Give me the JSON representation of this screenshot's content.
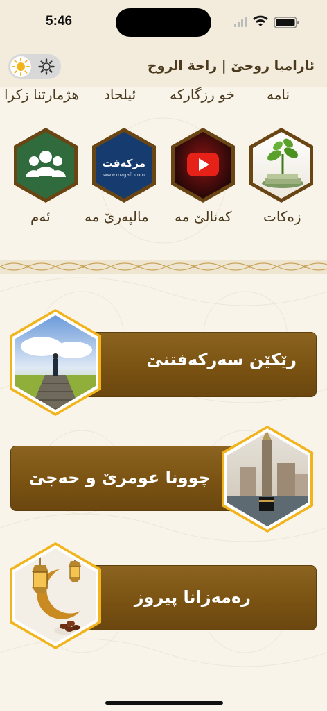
{
  "status_bar": {
    "time": "5:46"
  },
  "header": {
    "title": "ئاراميا روحێ | راحة الروح",
    "theme_toggle": {
      "light_icon": "sun-icon",
      "dark_icon": "gear-icon"
    }
  },
  "top_labels": [
    "نامە",
    "خو رزگاركە",
    "ئيلحاد",
    "هژمارتنا زكرا"
  ],
  "tiles": [
    {
      "label": "زەکات",
      "icon": "money-plant-icon"
    },
    {
      "label": "كەنالێ مە",
      "icon": "youtube-icon"
    },
    {
      "label": "مالپەرێ مە",
      "icon": "mzgaft-logo",
      "logo_text": "مزكەفت",
      "logo_sub": "www.mzgaft.com"
    },
    {
      "label": "ئەم",
      "icon": "users-icon"
    }
  ],
  "cards": [
    {
      "label": "رێكێن سەركەفتنێ",
      "image": "stairs-path-image"
    },
    {
      "label": "چوونا عومرێ و حەجێ",
      "image": "mecca-image"
    },
    {
      "label": "رەمەزانا پیروز",
      "image": "ramadan-lantern-image"
    }
  ],
  "colors": {
    "gold": "#f2b41c",
    "brown": "#7a5212",
    "background": "#f8f4ea"
  }
}
